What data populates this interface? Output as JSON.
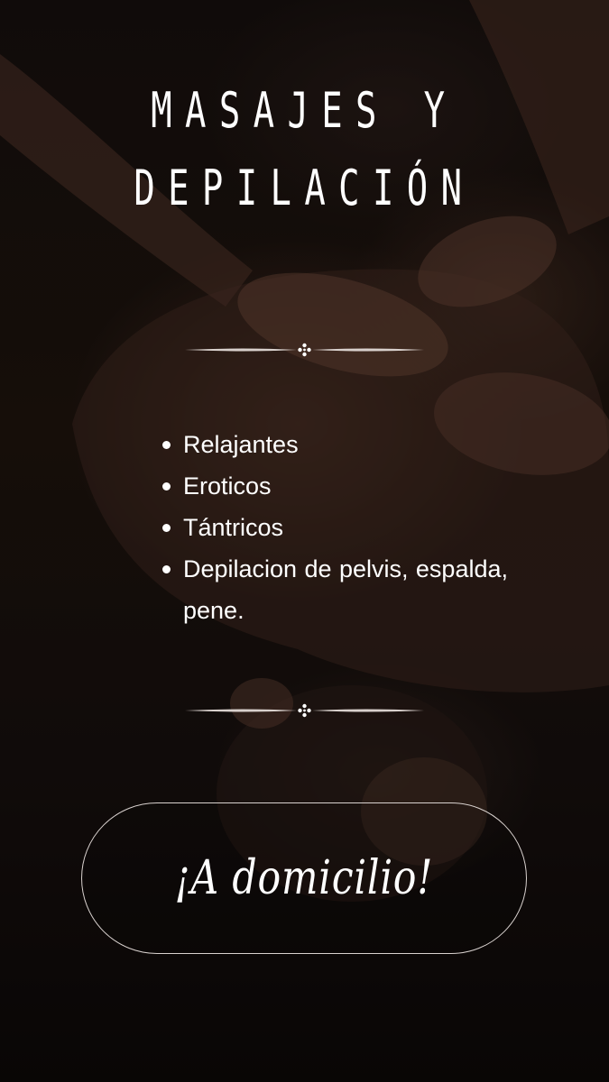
{
  "title": {
    "line1": "Masajes y",
    "line2": "Depilación"
  },
  "services": [
    {
      "label": "Relajantes"
    },
    {
      "label": "Eroticos"
    },
    {
      "label": "Tántricos"
    },
    {
      "label": "Depilacion de pelvis, espalda, pene."
    }
  ],
  "cta": {
    "label": "¡A domicilio!"
  },
  "colors": {
    "background": "#140d0b",
    "text": "#ffffff",
    "outline": "#d9d2cf"
  }
}
